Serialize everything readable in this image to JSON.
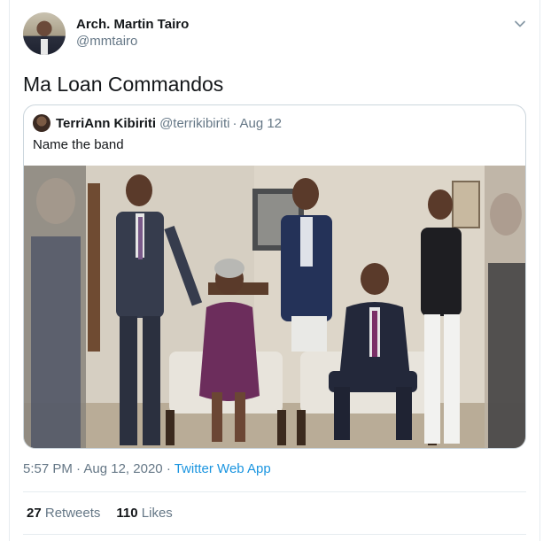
{
  "author": {
    "name": "Arch. Martin Tairo",
    "handle": "@mmtairo"
  },
  "tweet": {
    "text": "Ma Loan Commandos"
  },
  "quoted": {
    "name": "TerriAnn Kibiriti",
    "handle": "@terrikibiriti",
    "separator": "·",
    "date": "Aug 12",
    "text": "Name the band"
  },
  "meta": {
    "time": "5:57 PM",
    "separator": "·",
    "date": "Aug 12, 2020",
    "source": "Twitter Web App"
  },
  "stats": {
    "retweets_count": "27",
    "retweets_label": "Retweets",
    "likes_count": "110",
    "likes_label": "Likes"
  },
  "icons": {
    "menu": "chevron-down-icon"
  },
  "colors": {
    "link": "#1b95e0",
    "secondary_text": "#657786",
    "border": "#ccd6dd"
  }
}
